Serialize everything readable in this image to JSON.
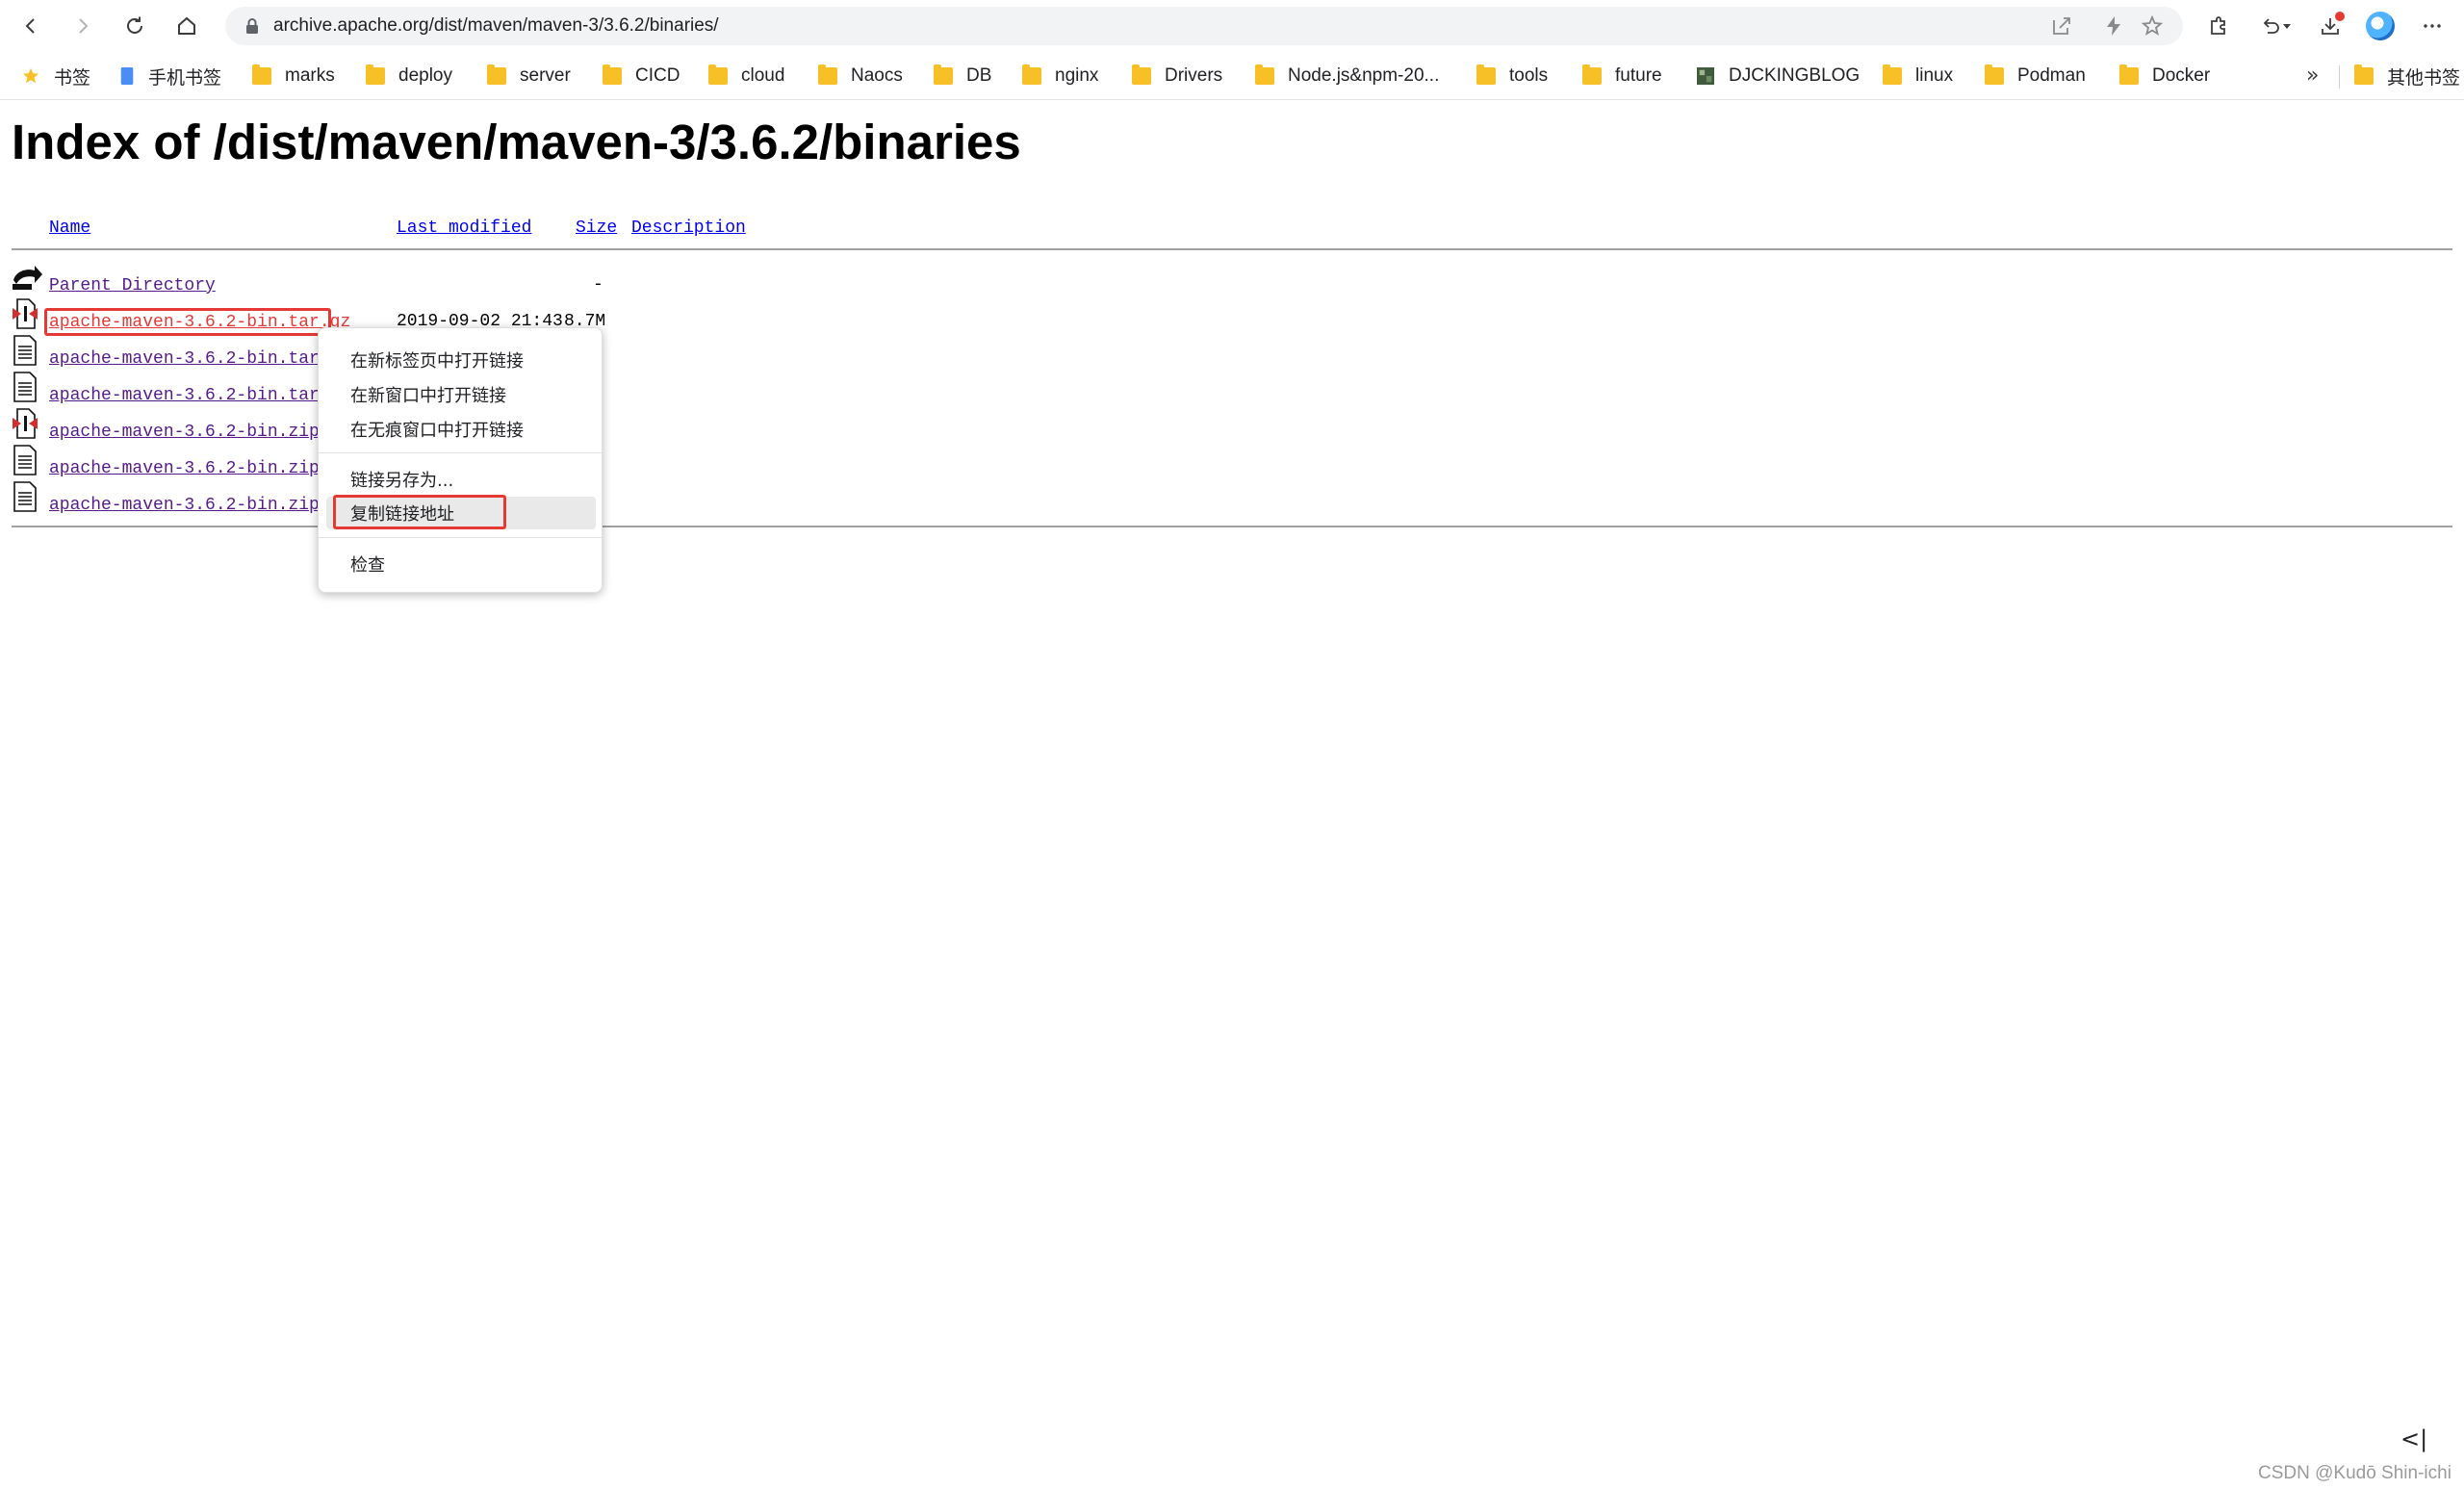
{
  "browser": {
    "url": "archive.apache.org/dist/maven/maven-3/3.6.2/binaries/",
    "bookmarks": [
      {
        "label": "书签",
        "icon": "star-icon"
      },
      {
        "label": "手机书签",
        "icon": "phone-bookmark-icon"
      },
      {
        "label": "marks",
        "icon": "folder-icon"
      },
      {
        "label": "deploy",
        "icon": "folder-icon"
      },
      {
        "label": "server",
        "icon": "folder-icon"
      },
      {
        "label": "CICD",
        "icon": "folder-icon"
      },
      {
        "label": "cloud",
        "icon": "folder-icon"
      },
      {
        "label": "Naocs",
        "icon": "folder-icon"
      },
      {
        "label": "DB",
        "icon": "folder-icon"
      },
      {
        "label": "nginx",
        "icon": "folder-icon"
      },
      {
        "label": "Drivers",
        "icon": "folder-icon"
      },
      {
        "label": "Node.js&npm-20...",
        "icon": "folder-icon"
      },
      {
        "label": "tools",
        "icon": "folder-icon"
      },
      {
        "label": "future",
        "icon": "folder-icon"
      },
      {
        "label": "DJCKINGBLOG",
        "icon": "site-favicon-icon"
      },
      {
        "label": "linux",
        "icon": "folder-icon"
      },
      {
        "label": "Podman",
        "icon": "folder-icon"
      },
      {
        "label": "Docker",
        "icon": "folder-icon"
      }
    ],
    "more_bookmarks": "»",
    "other_bookmarks": "其他书签"
  },
  "page": {
    "title": "Index of /dist/maven/maven-3/3.6.2/binaries",
    "columns": {
      "name": "Name",
      "last_modified": "Last modified",
      "size": "Size",
      "description": "Description"
    },
    "parent": {
      "label": "Parent Directory",
      "size": "-"
    },
    "files": [
      {
        "name": "apache-maven-3.6.2-bin.tar.gz",
        "modified": "2019-09-02 21:43",
        "size": "8.7M",
        "icon": "compressed-file-icon"
      },
      {
        "name": "apache-maven-3.6.2-bin.tar.gz",
        "icon": "text-file-icon"
      },
      {
        "name": "apache-maven-3.6.2-bin.tar.gz",
        "icon": "text-file-icon"
      },
      {
        "name": "apache-maven-3.6.2-bin.zip",
        "icon": "compressed-file-icon"
      },
      {
        "name": "apache-maven-3.6.2-bin.zip.as",
        "icon": "text-file-icon"
      },
      {
        "name": "apache-maven-3.6.2-bin.zip.sh",
        "icon": "text-file-icon"
      }
    ]
  },
  "context_menu": {
    "items": [
      "在新标签页中打开链接",
      "在新窗口中打开链接",
      "在无痕窗口中打开链接"
    ],
    "save_link": "链接另存为...",
    "copy_link": "复制链接地址",
    "inspect": "检查"
  },
  "sidebar_toggle": "<|",
  "watermark": "CSDN @Kudō Shin-ichi"
}
